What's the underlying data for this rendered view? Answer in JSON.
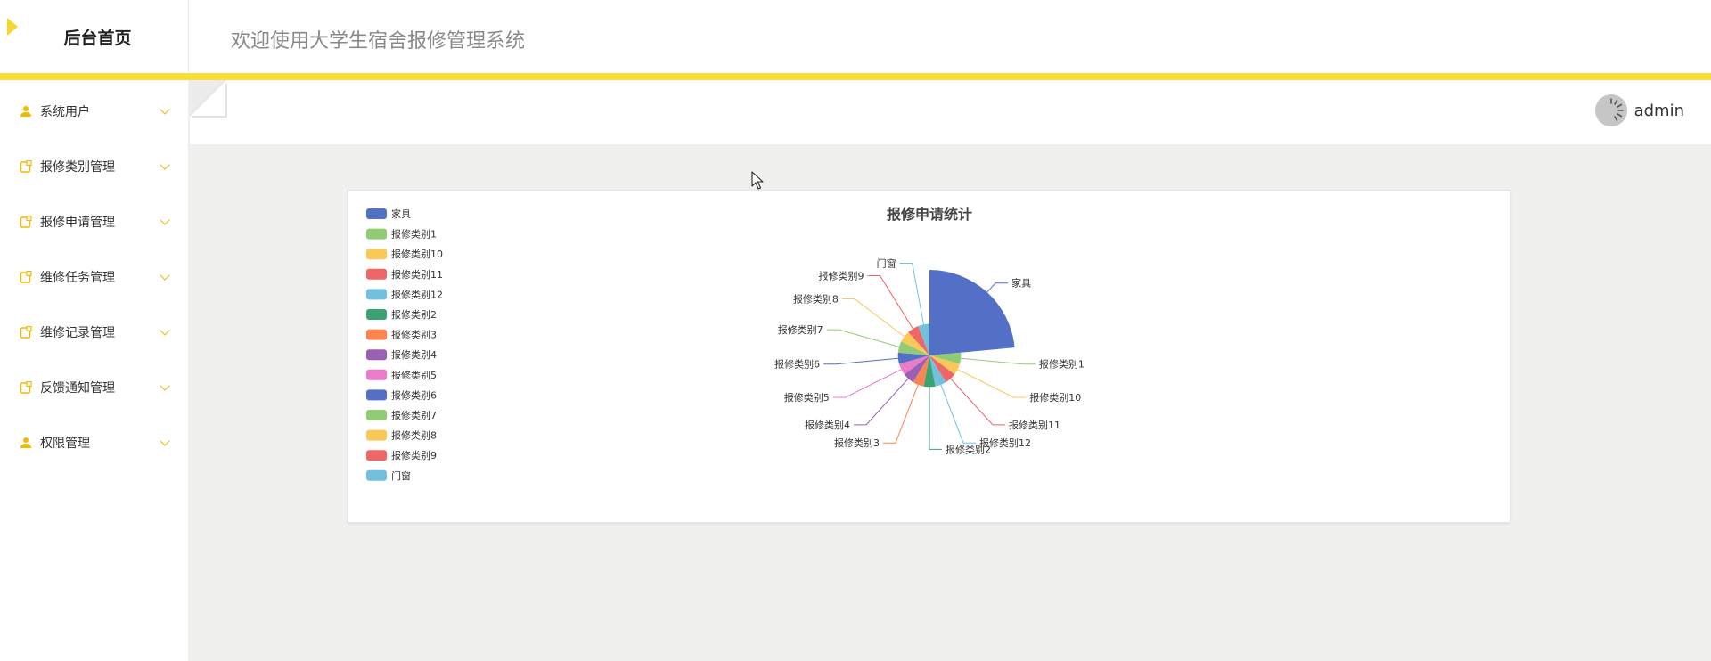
{
  "header": {
    "brand_title": "后台首页",
    "welcome": "欢迎使用大学生宿舍报修管理系统"
  },
  "sidebar": {
    "items": [
      {
        "label": "系统用户",
        "icon": "user-icon"
      },
      {
        "label": "报修类别管理",
        "icon": "document-icon"
      },
      {
        "label": "报修申请管理",
        "icon": "document-icon"
      },
      {
        "label": "维修任务管理",
        "icon": "document-icon"
      },
      {
        "label": "维修记录管理",
        "icon": "document-icon"
      },
      {
        "label": "反馈通知管理",
        "icon": "document-icon"
      },
      {
        "label": "权限管理",
        "icon": "user-icon"
      }
    ]
  },
  "user": {
    "name": "admin"
  },
  "colors": {
    "accent": "#f9dd3a",
    "icon": "#f5b800"
  },
  "chart_data": {
    "type": "pie",
    "title": "报修申请统计",
    "legend_position": "top-left",
    "categories": [
      "家具",
      "报修类别1",
      "报修类别10",
      "报修类别11",
      "报修类别12",
      "报修类别2",
      "报修类别3",
      "报修类别4",
      "报修类别5",
      "报修类别6",
      "报修类别7",
      "报修类别8",
      "报修类别9",
      "门窗"
    ],
    "values": [
      8,
      2,
      2,
      2,
      2,
      2,
      2,
      2,
      2,
      2,
      2,
      2,
      2,
      2
    ],
    "colors": [
      "#5470c6",
      "#91cc75",
      "#fac858",
      "#ee6666",
      "#73c0de",
      "#3ba272",
      "#fc8452",
      "#9a60b4",
      "#ea7ccc",
      "#5470c6",
      "#91cc75",
      "#fac858",
      "#ee6666",
      "#73c0de"
    ]
  }
}
